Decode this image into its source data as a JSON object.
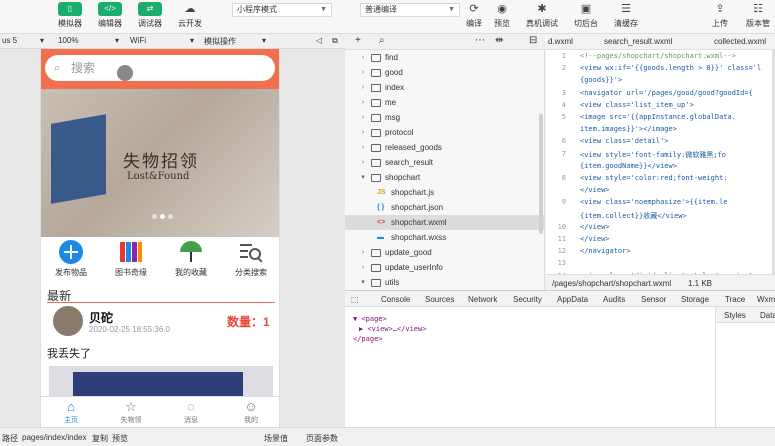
{
  "toolbar": {
    "simulator": "模拟器",
    "editor": "编辑器",
    "debugger": "调试器",
    "cloud": "云开发",
    "mode_select": "小程序模式",
    "compile_select": "普通编译",
    "compile": "编译",
    "preview": "预览",
    "remote_debug": "真机调试",
    "switch_bg": "切后台",
    "clear_cache": "清缓存",
    "upload": "上传",
    "version": "版本管"
  },
  "subbar": {
    "device": "us 5",
    "zoom": "100%",
    "network": "WiFi",
    "simulate_op": "模拟操作"
  },
  "phone": {
    "search_placeholder": "搜索",
    "banner_title": "失物招领",
    "banner_sub": "Lost&Found",
    "grid": [
      "发布物品",
      "图书奇缘",
      "我的收藏",
      "分类搜索"
    ],
    "section_title": "最新",
    "post": {
      "user": "贝砣",
      "date": "2020-02-25 18:55:36.0",
      "qty": "数量：1",
      "text": "我丢失了"
    },
    "tabs": [
      "主页",
      "失物领",
      "消息",
      "我的"
    ]
  },
  "tree": {
    "items": [
      {
        "name": "find",
        "type": "folder",
        "open": false
      },
      {
        "name": "good",
        "type": "folder",
        "open": false
      },
      {
        "name": "index",
        "type": "folder",
        "open": false
      },
      {
        "name": "me",
        "type": "folder",
        "open": false
      },
      {
        "name": "msg",
        "type": "folder",
        "open": false
      },
      {
        "name": "protocol",
        "type": "folder",
        "open": false
      },
      {
        "name": "released_goods",
        "type": "folder",
        "open": false
      },
      {
        "name": "search_result",
        "type": "folder",
        "open": false
      },
      {
        "name": "shopchart",
        "type": "folder",
        "open": true
      },
      {
        "name": "shopchart.js",
        "type": "js"
      },
      {
        "name": "shopchart.json",
        "type": "json"
      },
      {
        "name": "shopchart.wxml",
        "type": "wxml"
      },
      {
        "name": "shopchart.wxss",
        "type": "wxss"
      },
      {
        "name": "update_good",
        "type": "folder",
        "open": false
      },
      {
        "name": "update_userInfo",
        "type": "folder",
        "open": false
      },
      {
        "name": "utils",
        "type": "folder",
        "open": true
      }
    ]
  },
  "editor": {
    "tabs": [
      "d.wxml",
      "search_result.wxml",
      "collected.wxml"
    ],
    "lines": [
      {
        "n": "1",
        "t": "<!--pages/shopchart/shopchart.wxml-->"
      },
      {
        "n": "2",
        "t": "<view wx:if='{{goods.length > 0}}' class='l"
      },
      {
        "n": "",
        "t": "{goods}}'>"
      },
      {
        "n": "3",
        "t": "  <navigator url='/pages/good/good?goodId={"
      },
      {
        "n": "4",
        "t": "    <view class='list_item_up'>"
      },
      {
        "n": "5",
        "t": "      <image src='{{appInstance.globalData."
      },
      {
        "n": "",
        "t": "item.images}}'></image>"
      },
      {
        "n": "6",
        "t": "      <view class='detail'>"
      },
      {
        "n": "7",
        "t": "        <view style='font-family:微软雅黑;fo"
      },
      {
        "n": "",
        "t": "{item.goodName}}</view>"
      },
      {
        "n": "8",
        "t": "        <view style='color:red;font-weight:"
      },
      {
        "n": "",
        "t": "</view>"
      },
      {
        "n": "9",
        "t": "        <view class='noemphasize'>{{item.le"
      },
      {
        "n": "",
        "t": "{item.collect}}收藏</view>"
      },
      {
        "n": "10",
        "t": "      </view>"
      },
      {
        "n": "11",
        "t": "    </view>"
      },
      {
        "n": "12",
        "t": "  </navigator>"
      },
      {
        "n": "13",
        "t": ""
      },
      {
        "n": "14",
        "t": "  <view class='divide_line' style='margin-t"
      }
    ],
    "status_path": "/pages/shopchart/shopchart.wxml",
    "status_size": "1.1 KB"
  },
  "devtools": {
    "tabs": [
      "Console",
      "Sources",
      "Network",
      "Security",
      "AppData",
      "Audits",
      "Sensor",
      "Storage",
      "Trace",
      "Wxm"
    ],
    "xml": [
      "▼ <page>",
      "  ▶ <view>…</view>",
      "  </page>"
    ],
    "side_tabs": [
      "Styles",
      "Data"
    ]
  },
  "statusbar": {
    "label": "路径",
    "path": "pages/index/index",
    "copy": "复制",
    "preview": "预览",
    "scene": "场景值",
    "params": "页面参数"
  }
}
